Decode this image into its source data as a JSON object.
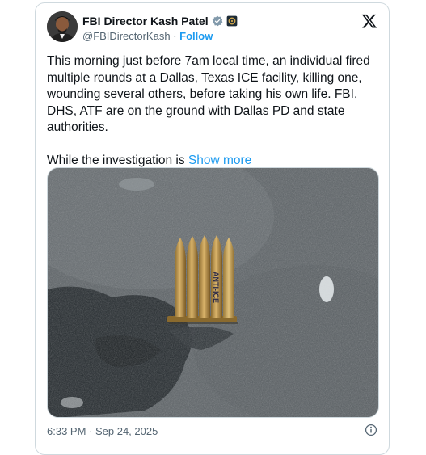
{
  "author": {
    "display_name": "FBI Director Kash Patel",
    "handle": "@FBIDirectorKash",
    "separator": "·",
    "follow_label": "Follow"
  },
  "post": {
    "paragraph1": "This morning just before 7am local time, an individual fired multiple rounds at a Dallas, Texas ICE facility, killing one, wounding several others, before taking his own life. FBI, DHS, ATF are on the ground with Dallas PD and state authorities.",
    "paragraph2_start": "While the investigation is",
    "show_more_label": "Show more",
    "image_overlay_text": "ANTI-ICE",
    "timestamp": "6:33 PM · Sep 24, 2025"
  },
  "icons": {
    "verified": "verified-badge-icon",
    "gov": "government-seal-icon",
    "platform": "x-logo-icon",
    "info": "info-icon"
  },
  "colors": {
    "link": "#1d9bf0",
    "secondary_text": "#536471",
    "verified_badge": "#829aab",
    "border": "#cfd9de"
  }
}
